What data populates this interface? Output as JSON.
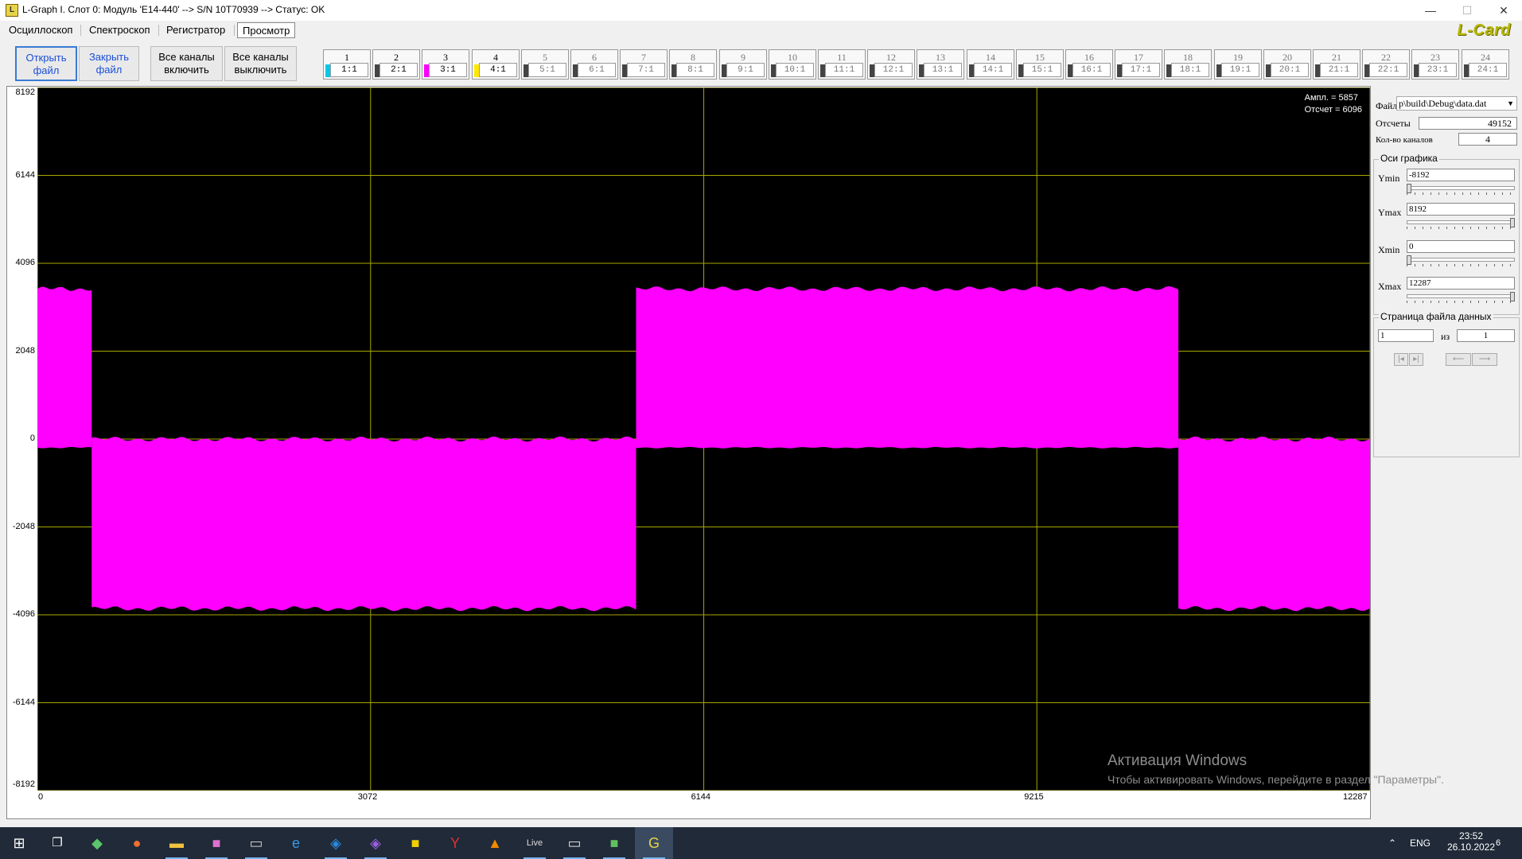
{
  "window": {
    "title": "L-Graph I. Слот 0:  Модуль 'E14-440' --> S/N 10T70939 --> Статус: OK",
    "app_icon": "lgraph-app-icon",
    "minimize": "—",
    "maximize": "☐",
    "close": "✕"
  },
  "menu": {
    "items": [
      "Осциллоскоп",
      "Спектроскоп",
      "Регистратор",
      "Просмотр"
    ],
    "active_index": 3,
    "logo": "L-Card"
  },
  "toolbar": {
    "open_file": [
      "Открыть",
      "файл"
    ],
    "close_file": [
      "Закрыть",
      "файл"
    ],
    "all_on": [
      "Все каналы",
      "включить"
    ],
    "all_off": [
      "Все каналы",
      "выключить"
    ],
    "channels": [
      {
        "num": "1",
        "ratio": "1:1",
        "color": "#00c8e8",
        "enabled": true
      },
      {
        "num": "2",
        "ratio": "2:1",
        "color": "#444444",
        "enabled": true
      },
      {
        "num": "3",
        "ratio": "3:1",
        "color": "#ff00ff",
        "enabled": true
      },
      {
        "num": "4",
        "ratio": "4:1",
        "color": "#ffe800",
        "enabled": true
      },
      {
        "num": "5",
        "ratio": "5:1",
        "color": "#444444",
        "enabled": false
      },
      {
        "num": "6",
        "ratio": "6:1",
        "color": "#444444",
        "enabled": false
      },
      {
        "num": "7",
        "ratio": "7:1",
        "color": "#444444",
        "enabled": false
      },
      {
        "num": "8",
        "ratio": "8:1",
        "color": "#444444",
        "enabled": false
      },
      {
        "num": "9",
        "ratio": "9:1",
        "color": "#444444",
        "enabled": false
      },
      {
        "num": "10",
        "ratio": "10:1",
        "color": "#444444",
        "enabled": false
      },
      {
        "num": "11",
        "ratio": "11:1",
        "color": "#444444",
        "enabled": false
      },
      {
        "num": "12",
        "ratio": "12:1",
        "color": "#444444",
        "enabled": false
      },
      {
        "num": "13",
        "ratio": "13:1",
        "color": "#444444",
        "enabled": false
      },
      {
        "num": "14",
        "ratio": "14:1",
        "color": "#444444",
        "enabled": false
      },
      {
        "num": "15",
        "ratio": "15:1",
        "color": "#444444",
        "enabled": false
      },
      {
        "num": "16",
        "ratio": "16:1",
        "color": "#444444",
        "enabled": false
      },
      {
        "num": "17",
        "ratio": "17:1",
        "color": "#444444",
        "enabled": false
      },
      {
        "num": "18",
        "ratio": "18:1",
        "color": "#444444",
        "enabled": false
      },
      {
        "num": "19",
        "ratio": "19:1",
        "color": "#444444",
        "enabled": false
      },
      {
        "num": "20",
        "ratio": "20:1",
        "color": "#444444",
        "enabled": false
      },
      {
        "num": "21",
        "ratio": "21:1",
        "color": "#444444",
        "enabled": false
      },
      {
        "num": "22",
        "ratio": "22:1",
        "color": "#444444",
        "enabled": false
      },
      {
        "num": "23",
        "ratio": "23:1",
        "color": "#444444",
        "enabled": false
      },
      {
        "num": "24",
        "ratio": "24:1",
        "color": "#444444",
        "enabled": false
      }
    ],
    "scroll_arrow": "▸"
  },
  "plot": {
    "readout_ampl": "Ампл. = 5857",
    "readout_sample": "Отсчет = 6096",
    "y_ticks": [
      "8192",
      "6144",
      "4096",
      "2048",
      "0",
      "-2048",
      "-4096",
      "-6144",
      "-8192"
    ],
    "x_ticks": [
      "0",
      "3072",
      "6144",
      "9215",
      "12287"
    ],
    "grid_color": "#a8a800",
    "signal_color": "#ff00ff",
    "background": "#000000"
  },
  "chart_data": {
    "type": "area",
    "xlim": [
      0,
      12287
    ],
    "ylim": [
      -8192,
      8192
    ],
    "grid": true,
    "series": [
      {
        "color": "#ff00ff",
        "segments": [
          {
            "x_start": 0,
            "x_end": 500,
            "upper": 3500,
            "lower": -200
          },
          {
            "x_start": 500,
            "x_end": 5520,
            "upper": 0,
            "lower": -3950
          },
          {
            "x_start": 5520,
            "x_end": 10520,
            "upper": 3500,
            "lower": -200
          },
          {
            "x_start": 10520,
            "x_end": 12287,
            "upper": 0,
            "lower": -3950
          }
        ]
      }
    ]
  },
  "panel": {
    "file_label": "Файл",
    "file_value": "p\\build\\Debug\\data.dat",
    "samples_label": "Отсчеты",
    "samples_value": "49152",
    "channels_label": "Кол-во каналов",
    "channels_value": "4",
    "axes_title": "Оси графика",
    "ymin_label": "Ymin",
    "ymin_value": "-8192",
    "ymax_label": "Ymax",
    "ymax_value": "8192",
    "xmin_label": "Xmin",
    "xmin_value": "0",
    "xmax_label": "Xmax",
    "xmax_value": "12287",
    "page_title": "Страница файла данных",
    "page_value": "1",
    "page_of": "из",
    "page_total": "1"
  },
  "watermark": {
    "line1": "Активация Windows",
    "line2": "Чтобы активировать Windows, перейдите в раздел \"Параметры\"."
  },
  "taskbar": {
    "lang": "ENG",
    "time": "23:52",
    "date": "26.10.2022",
    "notifications": "6"
  }
}
